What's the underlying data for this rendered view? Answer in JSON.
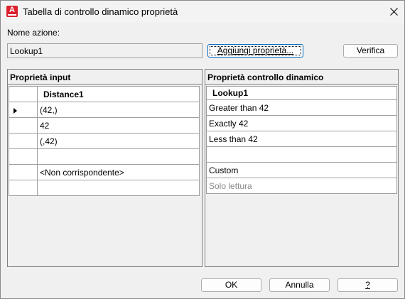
{
  "window": {
    "title": "Tabella di controllo dinamico proprietà"
  },
  "action": {
    "label": "Nome azione:",
    "value": "Lookup1"
  },
  "buttons": {
    "add_property": "Aggiungi proprietà...",
    "verify": "Verifica",
    "ok": "OK",
    "cancel": "Annulla",
    "help": "?"
  },
  "input_panel": {
    "header": "Proprietà input",
    "column": "Distance1",
    "rows": [
      "(42,)",
      "42",
      "(,42)",
      "",
      "<Non corrispondente>",
      ""
    ],
    "selected_row": 0
  },
  "lookup_panel": {
    "header": "Proprietà controllo dinamico",
    "column": "Lookup1",
    "rows": [
      "Greater than 42",
      "Exactly 42",
      "Less than 42",
      "",
      "Custom",
      "Solo lettura"
    ]
  },
  "colors": {
    "focus_border": "#0067c0",
    "app_icon": "#d9232e",
    "readonly_text": "#8a8a8a"
  },
  "icons": {
    "app": "autocad-icon",
    "close": "close-icon",
    "row_selector": "row-pointer-icon"
  }
}
